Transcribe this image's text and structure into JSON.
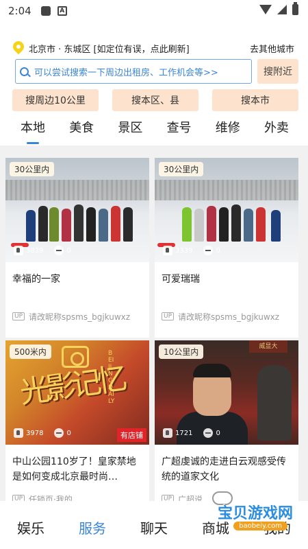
{
  "status_bar": {
    "time": "2:04",
    "app_badge": "A"
  },
  "location": {
    "city_text": "北京市 · 东城区 [如定位有误，点此刷新]",
    "other_city_label": "去其他城市"
  },
  "search": {
    "placeholder": "可以尝试搜索一下周边出租房、工作机会等>>",
    "nearby_button": "搜附近"
  },
  "quick_buttons": [
    "搜周边10公里",
    "搜本区、县",
    "搜本市"
  ],
  "tabs": [
    "本地",
    "美食",
    "景区",
    "查号",
    "维修",
    "外卖"
  ],
  "active_tab": "本地",
  "cards": [
    {
      "distance": "30公里内",
      "likes": "3839",
      "comments": "0",
      "title": "幸福的一家",
      "user": "请改昵称spsms_bgjkuwxz",
      "user_badge": "UP",
      "photo": "snow-group"
    },
    {
      "distance": "30公里内",
      "likes": "3339",
      "comments": "0",
      "title": "可爱瑞瑞",
      "user": "请改昵称spsms_bgjkuwxz",
      "user_badge": "UP",
      "photo": "snow-group"
    },
    {
      "distance": "500米内",
      "likes": "3978",
      "comments": "0",
      "title": "中山公园110岁了！皇家禁地是如何变成北京最时尚…",
      "user": "任锁页·我的",
      "user_badge": "UP",
      "photo": "poster",
      "store_tag": "有店铺",
      "poster_text": "光影记忆",
      "poster_side": "BEIJING DAILY"
    },
    {
      "distance": "10公里内",
      "likes": "1721",
      "comments": "0",
      "title": "广超虔诚的走进白云观感受传统的道家文化",
      "user": "广超说…",
      "user_badge": "UP",
      "photo": "temple",
      "plaque_text": "威显大"
    }
  ],
  "bottom_nav": [
    "娱乐",
    "服务",
    "聊天",
    "商城",
    "我的"
  ],
  "bottom_nav_active": "服务",
  "watermark": {
    "text": "宝贝游戏网",
    "url": "baobeiy.com"
  },
  "colors": {
    "accent": "#3a86d6",
    "chip_bg": "#fde3cd",
    "pin": "#f7d21a",
    "store_tag": "#e0242a"
  }
}
